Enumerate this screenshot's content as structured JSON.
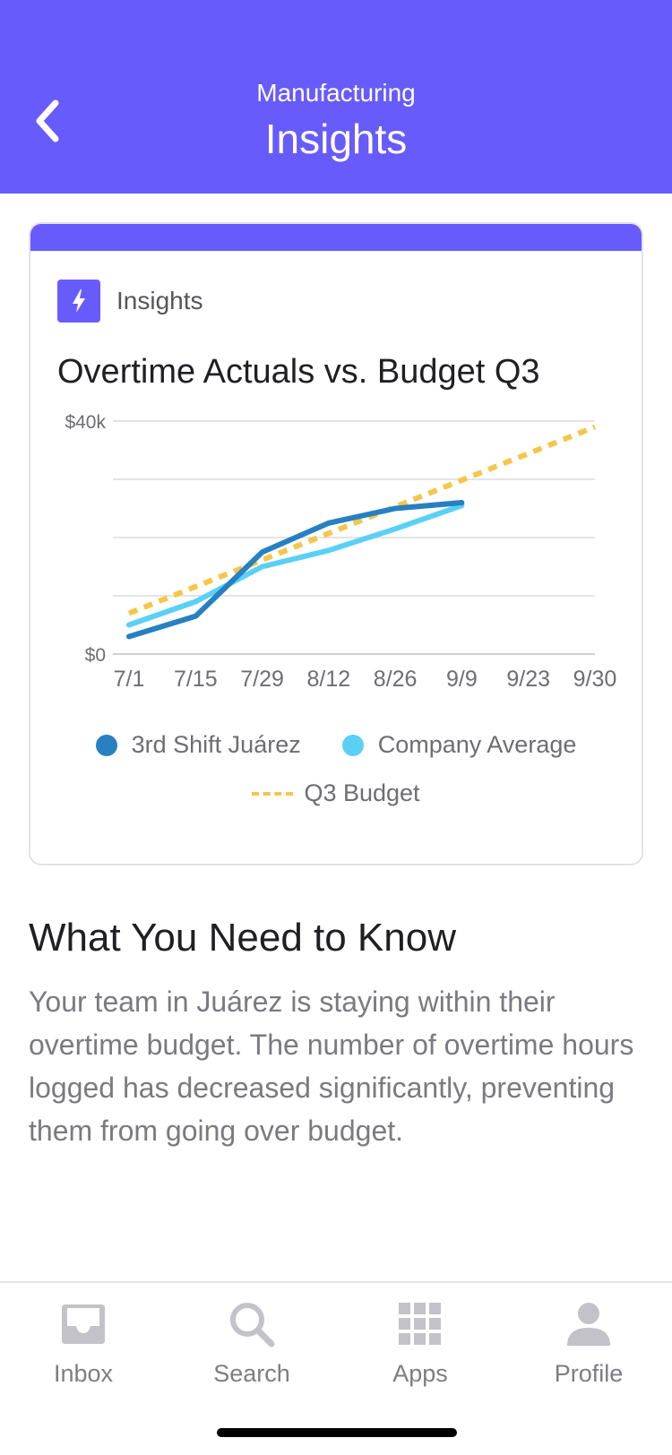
{
  "header": {
    "subtitle": "Manufacturing",
    "title": "Insights"
  },
  "card": {
    "badge_label": "Insights",
    "title": "Overtime Actuals vs. Budget Q3"
  },
  "chart_data": {
    "type": "line",
    "title": "Overtime Actuals vs. Budget Q3",
    "x": [
      "7/1",
      "7/15",
      "7/29",
      "8/12",
      "8/26",
      "9/9",
      "9/23",
      "9/30"
    ],
    "y_tick_labels": [
      "$0",
      "$40k"
    ],
    "ylim": [
      0,
      40000
    ],
    "grid": true,
    "legend_position": "bottom",
    "series": [
      {
        "name": "3rd Shift Juárez",
        "color": "#2680c2",
        "style": "solid",
        "points": [
          {
            "x": "7/1",
            "y": 3000
          },
          {
            "x": "7/15",
            "y": 6500
          },
          {
            "x": "7/29",
            "y": 17500
          },
          {
            "x": "8/12",
            "y": 22500
          },
          {
            "x": "8/26",
            "y": 25000
          },
          {
            "x": "9/9",
            "y": 26000
          }
        ]
      },
      {
        "name": "Company Average",
        "color": "#5bd0f7",
        "style": "solid",
        "points": [
          {
            "x": "7/1",
            "y": 5000
          },
          {
            "x": "7/15",
            "y": 9000
          },
          {
            "x": "7/29",
            "y": 15000
          },
          {
            "x": "8/12",
            "y": 17800
          },
          {
            "x": "8/26",
            "y": 21500
          },
          {
            "x": "9/9",
            "y": 25500
          }
        ]
      },
      {
        "name": "Q3 Budget",
        "color": "#f5c64a",
        "style": "dashed",
        "points": [
          {
            "x": "7/1",
            "y": 7000
          },
          {
            "x": "9/30",
            "y": 39000
          }
        ]
      }
    ]
  },
  "know": {
    "title": "What You Need to Know",
    "body": "Your team in Juárez is staying within their overtime budget. The number of overtime hours logged has decreased significantly, preventing them from going over budget."
  },
  "tabbar": {
    "items": [
      {
        "label": "Inbox",
        "icon": "inbox-icon"
      },
      {
        "label": "Search",
        "icon": "search-icon"
      },
      {
        "label": "Apps",
        "icon": "apps-grid-icon"
      },
      {
        "label": "Profile",
        "icon": "profile-icon"
      }
    ]
  },
  "colors": {
    "brand": "#675bfc",
    "budget": "#f5c64a",
    "actuals": "#2680c2",
    "average": "#5bd0f7"
  }
}
